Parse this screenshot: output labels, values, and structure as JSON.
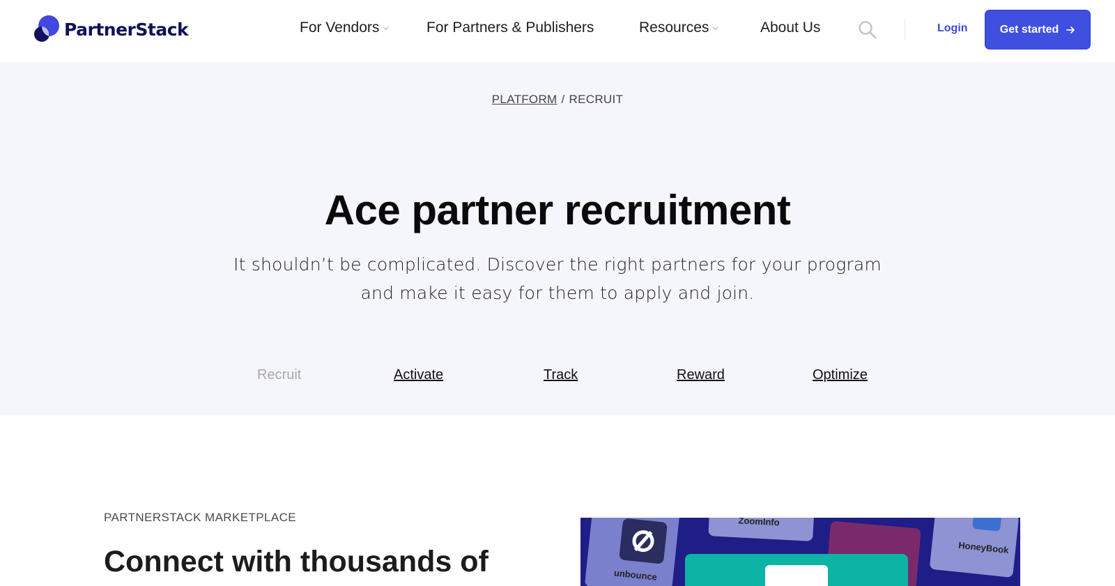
{
  "brand": {
    "name": "PartnerStack",
    "logo_colors": {
      "primary": "#4447e0",
      "dark": "#131060"
    }
  },
  "nav": {
    "items": [
      {
        "label": "For Vendors",
        "has_dropdown": true
      },
      {
        "label": "For Partners & Publishers",
        "has_dropdown": false
      },
      {
        "label": "Resources",
        "has_dropdown": true
      },
      {
        "label": "About Us",
        "has_dropdown": false
      }
    ],
    "search_icon": "search-icon",
    "login_label": "Login",
    "cta_label": "Get started",
    "cta_icon": "arrow-right-icon"
  },
  "breadcrumb": {
    "parent": "PLATFORM",
    "separator": "/",
    "current": "RECRUIT"
  },
  "hero": {
    "title": "Ace partner recruitment",
    "subtitle": "It shouldn’t be complicated. Discover the right partners for your program and make it easy for them to apply and join.",
    "tabs": [
      {
        "label": "Recruit",
        "active": true
      },
      {
        "label": "Activate",
        "active": false
      },
      {
        "label": "Track",
        "active": false
      },
      {
        "label": "Reward",
        "active": false
      },
      {
        "label": "Optimize",
        "active": false
      }
    ]
  },
  "marketplace": {
    "eyebrow": "PARTNERSTACK MARKETPLACE",
    "title": "Connect with thousands of",
    "promo_cards": [
      "unbounce",
      "ZoomInfo",
      "HoneyBook"
    ]
  },
  "colors": {
    "accent": "#3f4fe0",
    "hero_bg": "#f5f5fc",
    "promo_bg": "#1e1e86",
    "promo_highlight": "#0db3a5"
  }
}
